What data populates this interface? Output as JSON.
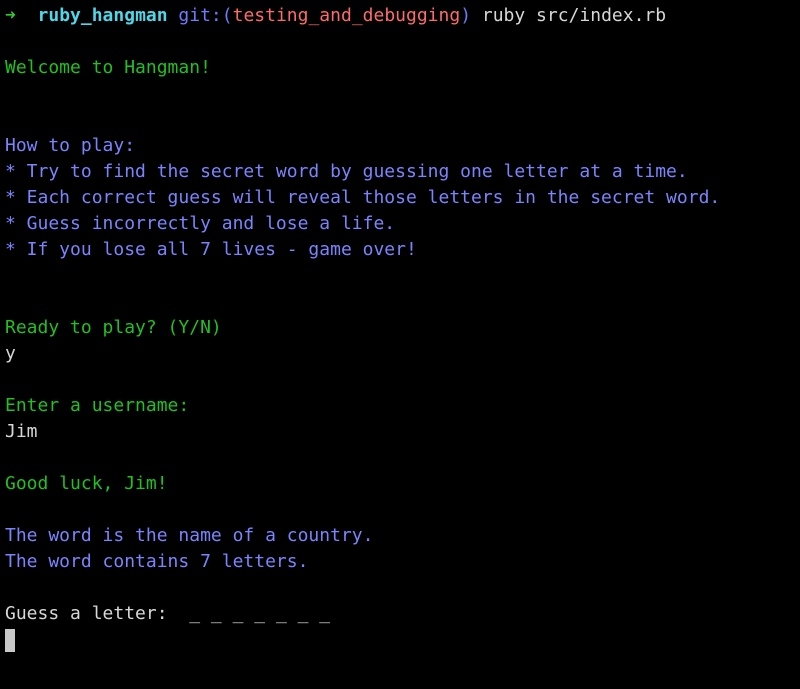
{
  "prompt": {
    "arrow": "➜",
    "directory": "ruby_hangman",
    "git_label": "git:(",
    "branch": "testing_and_debugging",
    "git_close": ")",
    "command": "ruby src/index.rb"
  },
  "welcome": "Welcome to Hangman!",
  "how_to": {
    "heading": "How to play:",
    "rules": [
      "* Try to find the secret word by guessing one letter at a time.",
      "* Each correct guess will reveal those letters in the secret word.",
      "* Guess incorrectly and lose a life.",
      "* If you lose all 7 lives - game over!"
    ]
  },
  "ready": {
    "question": "Ready to play? (Y/N)",
    "answer": "y"
  },
  "username": {
    "question": "Enter a username:",
    "answer": "Jim"
  },
  "good_luck": "Good luck, Jim!",
  "hints": {
    "category": "The word is the name of a country.",
    "length": "The word contains 7 letters."
  },
  "guess": {
    "label": "Guess a letter:",
    "word_blanks": "_ _ _ _ _ _ _"
  },
  "colors": {
    "green": "#1fc21f",
    "blue": "#7b84ff",
    "cyan": "#4fd6e8",
    "red": "#ff6b6b",
    "background": "#000000"
  }
}
